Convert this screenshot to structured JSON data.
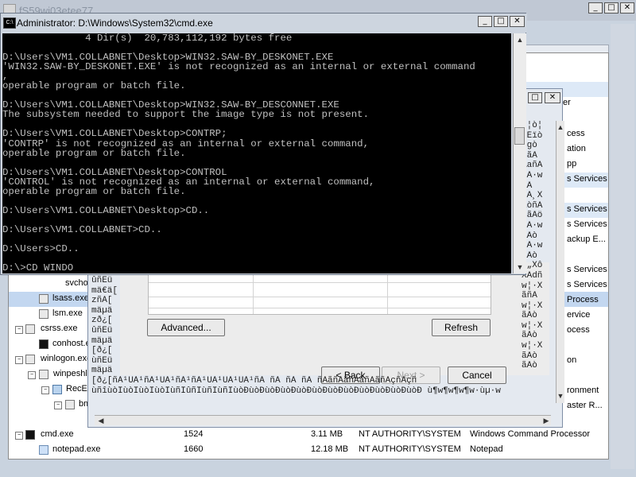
{
  "background_window": {
    "title": "fS59wi03etee77",
    "processes": [
      {
        "indent": 0,
        "icon": "process",
        "name": "csrss.exe",
        "pid": "",
        "mem": "",
        "user": "",
        "desc": ""
      },
      {
        "indent": 1,
        "icon": "cmd",
        "name": "conhost.exe",
        "pid": "",
        "mem": "",
        "user": "",
        "desc": ""
      },
      {
        "indent": 0,
        "icon": "process",
        "name": "winlogon.exe",
        "pid": "",
        "mem": "",
        "user": "",
        "desc": ""
      },
      {
        "indent": 1,
        "icon": "process",
        "name": "winpeshl.exe",
        "pid": "",
        "mem": "",
        "user": "",
        "desc": ""
      },
      {
        "indent": 2,
        "icon": "flag",
        "name": "RecEnv.exe",
        "pid": "",
        "mem": "",
        "user": "",
        "desc": ""
      },
      {
        "indent": 3,
        "icon": "process",
        "name": "bmr.exe",
        "pid": "",
        "mem": "",
        "user": "",
        "desc": ""
      },
      {
        "indent": 0,
        "icon": "cmd",
        "name": "cmd.exe",
        "pid": "1524",
        "mem": "3.11 MB",
        "user": "NT AUTHORITY\\SYSTEM",
        "desc": "Windows Command Processor"
      },
      {
        "indent": 1,
        "icon": "notepad",
        "name": "notepad.exe",
        "pid": "1660",
        "mem": "12.18 MB",
        "user": "NT AUTHORITY\\SYSTEM",
        "desc": "Notepad"
      }
    ],
    "upper_rows": [
      {
        "name": "svchost.exe"
      },
      {
        "name": "lsass.exe"
      },
      {
        "name": "lsm.exe"
      }
    ],
    "desc_fragments": [
      "er",
      "cess",
      "ation",
      "pp",
      "s Services",
      "s Services",
      "s Services",
      "ackup E...",
      "s Services",
      "s Services",
      "Process",
      "ervice",
      "ocess",
      "on",
      "ronment",
      "aster R..."
    ]
  },
  "wizard": {
    "advanced_label": "Advanced...",
    "refresh_label": "Refresh",
    "back_label": "< Back",
    "next_label": "Next >",
    "cancel_label": "Cancel",
    "garbled_lines": [
      "ûñËü",
      "mä€ä[",
      "zñÀ[",
      "mäµä",
      "zð¿[",
      "ûñËü",
      "mäµä",
      "[ð¿[",
      "ùñËü",
      "mäµä",
      "[ð¿[ñÀ¹ÚÀ¹ñÀ¹ÚÀ¹ñÀ¹ñÀ¹ÚÀ¹ÚÀ¹ÚÀ¹ñÀ ñÀ ñÀ ñÀ ñÀãñÀãñÀãñÀãñÀçñÀçñ",
      "ùñîùòÎùòÎùòÎùòÎùñÎûñÎùñÎùñÎùòÐùòÐùòÐùòÐùòÐùòÐùòÐùòÐùòÐùòÐùòÐùòÐ ù¶w¶w¶w¶w·ùµ·w"
    ],
    "garbled_right": [
      "ò¦ò¦",
      "ÊÉïò",
      "Egò",
      "¯ãÃ",
      "ÄañÄ",
      "ùÄ·w",
      "ãÃ",
      "ùÄ¸X",
      "ãòñÄ",
      "çãÂö",
      "ùÄ·w",
      "ãÃò",
      "ùÄ·w",
      "ãÃò",
      "ù„Xô",
      "XÄdñ",
      "w¦·X",
      "ãñÃ",
      "w¦·X",
      "ãÃò",
      "w¦·X",
      "ãÃò",
      "w¦·X",
      "ãÃò",
      "ãÃò"
    ]
  },
  "cmd": {
    "title": "Administrator: D:\\Windows\\System32\\cmd.exe",
    "lines": [
      "              4 Dir(s)  20,783,112,192 bytes free",
      "",
      "D:\\Users\\VM1.COLLABNET\\Desktop>WIN32.SAW-BY_DESKONET.EXE",
      "'WIN32.SAW-BY_DESKONET.EXE' is not recognized as an internal or external command",
      ",",
      "operable program or batch file.",
      "",
      "D:\\Users\\VM1.COLLABNET\\Desktop>WIN32.SAW-BY_DESCONNET.EXE",
      "The subsystem needed to support the image type is not present.",
      "",
      "D:\\Users\\VM1.COLLABNET\\Desktop>CONTRP;",
      "'CONTRP' is not recognized as an internal or external command,",
      "operable program or batch file.",
      "",
      "D:\\Users\\VM1.COLLABNET\\Desktop>CONTROL",
      "'CONTROL' is not recognized as an internal or external command,",
      "operable program or batch file.",
      "",
      "D:\\Users\\VM1.COLLABNET\\Desktop>CD..",
      "",
      "D:\\Users\\VM1.COLLABNET>CD..",
      "",
      "D:\\Users>CD..",
      "",
      "D:\\>CD WINDO"
    ]
  },
  "colors": {
    "console_bg": "#000000",
    "console_fg": "#c0c0c0",
    "row_highlight": "#dde9f7"
  }
}
